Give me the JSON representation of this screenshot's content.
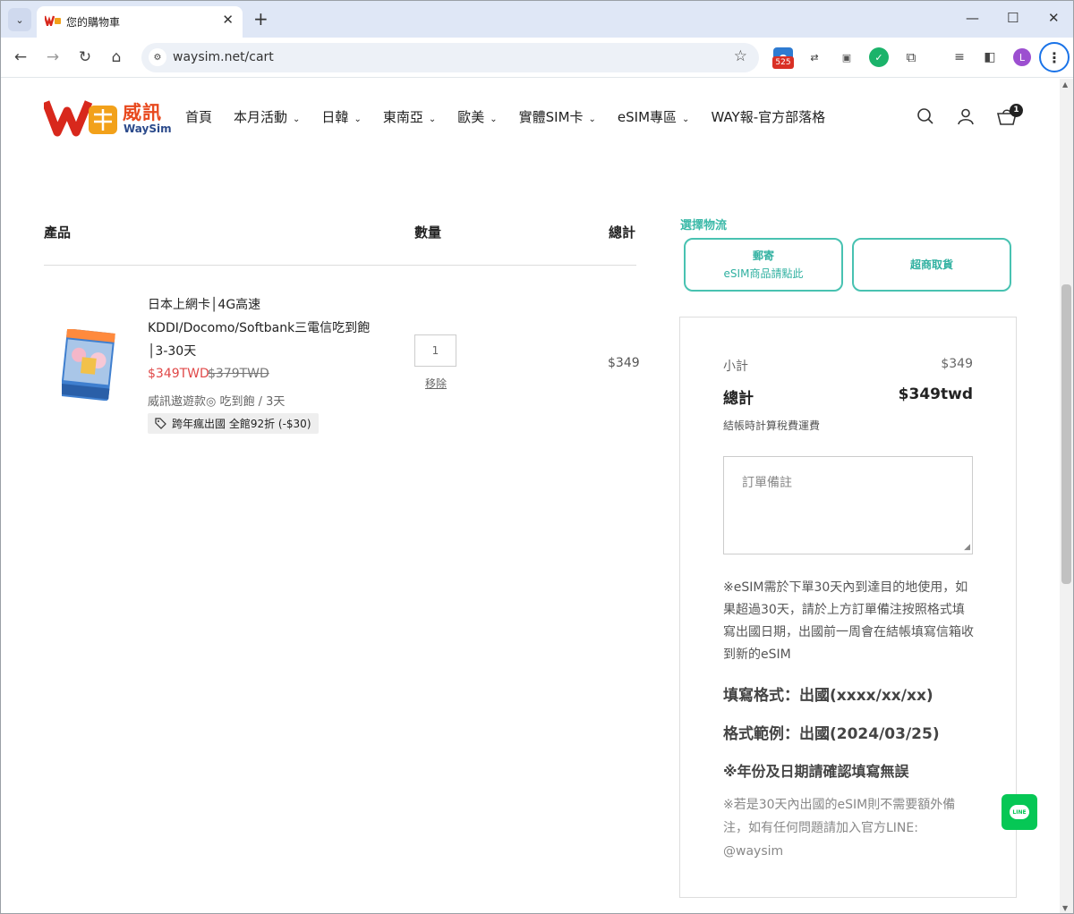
{
  "browser": {
    "tab_title": "您的購物車",
    "url": "waysim.net/cart",
    "extension_badge": "525",
    "profile_initial": "L"
  },
  "header": {
    "brand_name": "威訊",
    "brand_sub": "WaySim",
    "nav": [
      "首頁",
      "本月活動",
      "日韓",
      "東南亞",
      "歐美",
      "實體SIM卡",
      "eSIM專區",
      "WAY報-官方部落格"
    ],
    "cart_count": "1"
  },
  "cart": {
    "col_product": "產品",
    "col_quantity": "數量",
    "col_total": "總計",
    "item": {
      "name": "日本上網卡│4G高速KDDI/Docomo/Softbank三電信吃到飽│3-30天",
      "sale_price": "$349TWD",
      "original_price": "$379TWD",
      "variant": "威訊遨遊款◎ 吃到飽 / 3天",
      "discount": "跨年瘋出國 全館92折 (-$30)",
      "quantity": "1",
      "remove_label": "移除",
      "line_total": "$349"
    }
  },
  "shipping": {
    "label": "選擇物流",
    "option1_title": "郵寄",
    "option1_sub": "eSIM商品請點此",
    "option2_title": "超商取貨"
  },
  "summary": {
    "subtotal_label": "小計",
    "subtotal_value": "$349",
    "total_label": "總計",
    "total_value": "$349twd",
    "tax_note": "結帳時計算稅費運費",
    "note_placeholder": "訂單備註",
    "info1": "※eSIM需於下單30天內到達目的地使用，如果超過30天，請於上方訂單備注按照格式填寫出國日期，出國前一周會在結帳填寫信箱收到新的eSIM",
    "format_line": "填寫格式：出國(xxxx/xx/xx)",
    "example_line": "格式範例：出國(2024/03/25)",
    "confirm_line": "※年份及日期請確認填寫無誤",
    "info2": "※若是30天內出國的eSIM則不需要額外備注，如有任何問題請加入官方LINE: @waysim"
  },
  "colors": {
    "accent": "#48c2b1",
    "sale": "#e04848",
    "brand_red": "#e8491e",
    "line_green": "#06c755"
  }
}
